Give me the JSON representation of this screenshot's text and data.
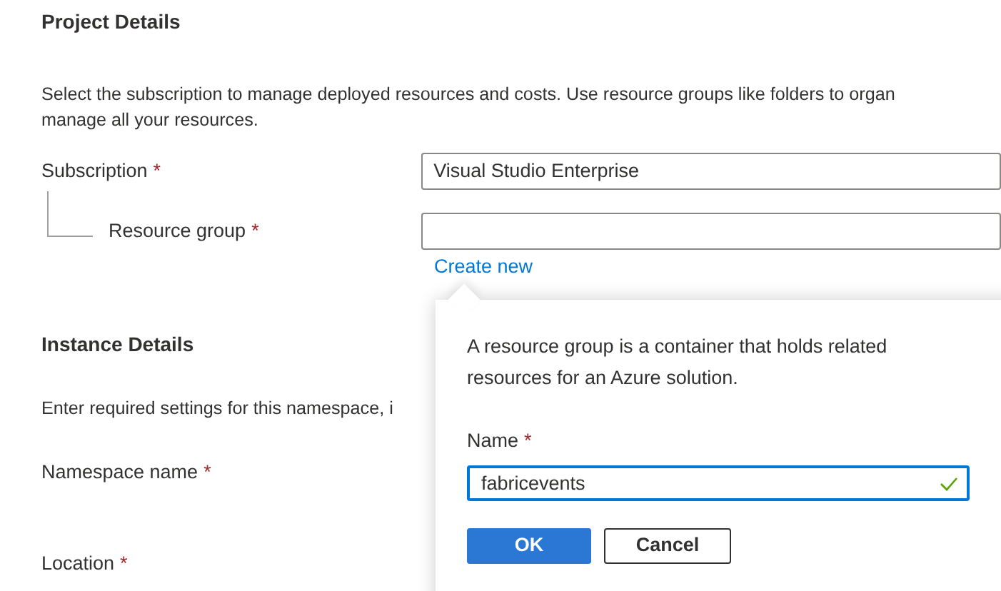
{
  "project_details": {
    "heading": "Project Details",
    "description_lines": [
      "Select the subscription to manage deployed resources and costs. Use resource groups like folders to organ",
      "manage all your resources."
    ],
    "subscription": {
      "label": "Subscription",
      "required_mark": "*",
      "value": "Visual Studio Enterprise"
    },
    "resource_group": {
      "label": "Resource group",
      "required_mark": "*",
      "link": "Create new"
    }
  },
  "instance_details": {
    "heading": "Instance Details",
    "description": "Enter required settings for this namespace, i",
    "fields": [
      {
        "label": "Namespace name",
        "required_mark": "*"
      },
      {
        "label": "Location",
        "required_mark": "*"
      }
    ]
  },
  "create_popup": {
    "description": "A resource group is a container that holds related resources for an Azure solution.",
    "name_label": "Name",
    "required_mark": "*",
    "name_value": "fabricevents",
    "valid": true,
    "buttons": [
      {
        "label": "OK",
        "kind": "primary"
      },
      {
        "label": "Cancel",
        "kind": "secondary"
      }
    ]
  }
}
